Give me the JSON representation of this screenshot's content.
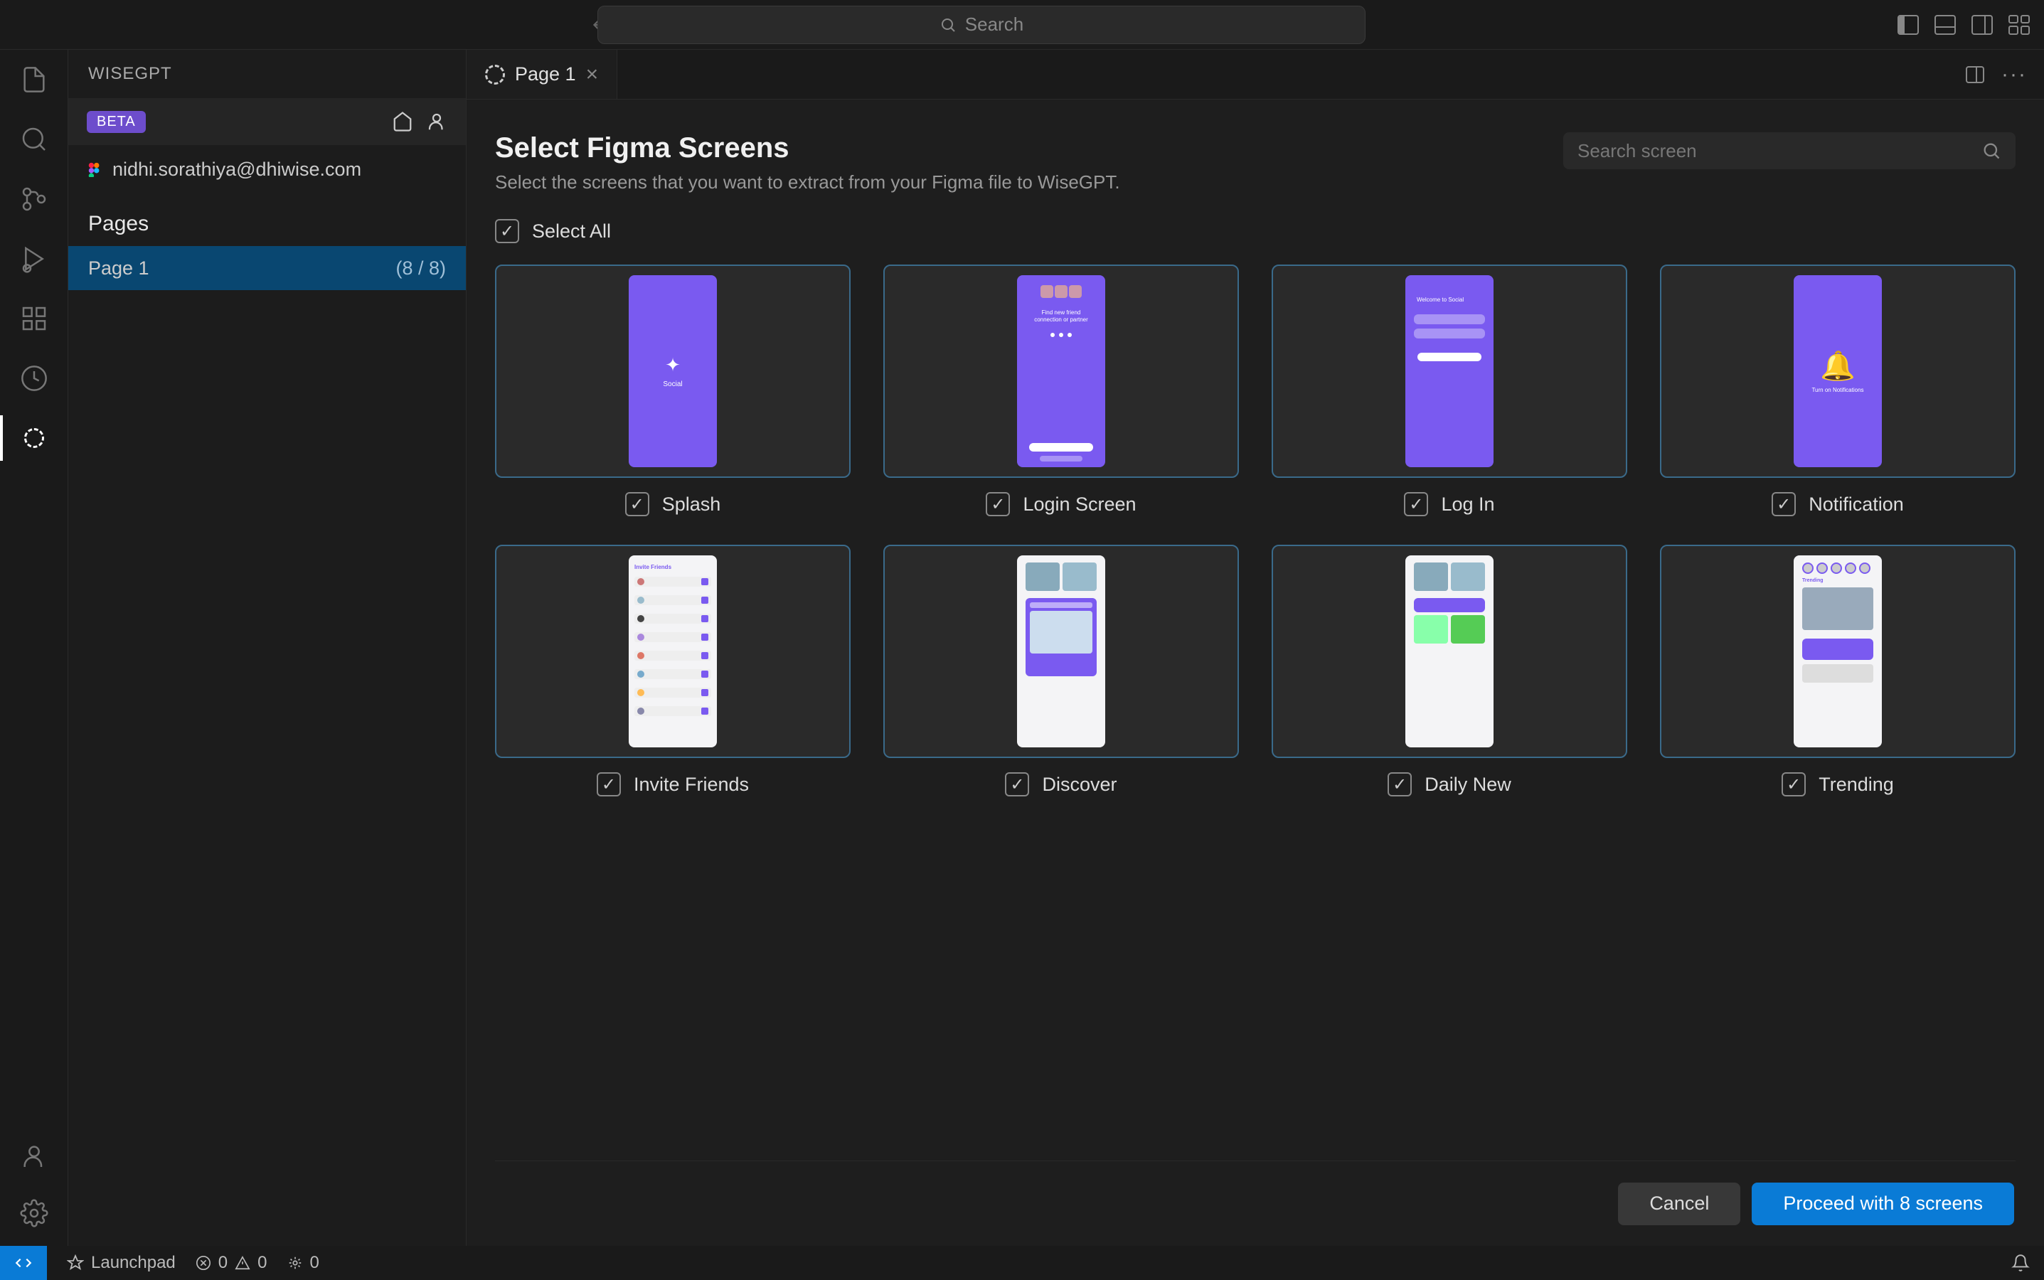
{
  "titlebar": {
    "search_placeholder": "Search"
  },
  "sidebar": {
    "title": "WISEGPT",
    "beta_label": "BETA",
    "user_email": "nidhi.sorathiya@dhiwise.com",
    "pages_header": "Pages",
    "pages": [
      {
        "name": "Page 1",
        "count": "(8 / 8)"
      }
    ]
  },
  "tab": {
    "label": "Page 1"
  },
  "content": {
    "title": "Select Figma Screens",
    "subtitle": "Select the screens that you want to extract from your Figma file to WiseGPT.",
    "search_screen_placeholder": "Search screen",
    "select_all_label": "Select All",
    "screens": [
      {
        "label": "Splash"
      },
      {
        "label": "Login Screen"
      },
      {
        "label": "Log In"
      },
      {
        "label": "Notification"
      },
      {
        "label": "Invite Friends"
      },
      {
        "label": "Discover"
      },
      {
        "label": "Daily New"
      },
      {
        "label": "Trending"
      }
    ],
    "cancel_label": "Cancel",
    "proceed_label": "Proceed with 8 screens"
  },
  "statusbar": {
    "launchpad": "Launchpad",
    "errors": "0",
    "warnings": "0",
    "ports": "0"
  }
}
